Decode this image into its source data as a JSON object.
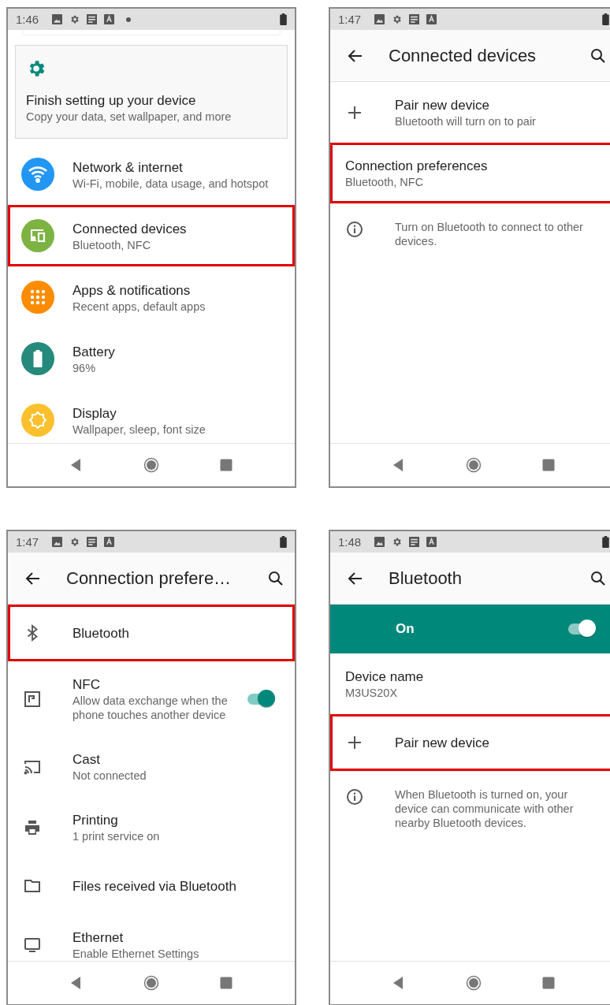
{
  "screens": [
    {
      "status": {
        "time": "1:46",
        "notification_dot": true
      },
      "items": [
        {
          "kind": "card",
          "title": "Finish setting up your device",
          "subtitle": "Copy your data, set wallpaper, and more",
          "highlighted": false
        },
        {
          "kind": "row",
          "title": "Network & internet",
          "subtitle": "Wi-Fi, mobile, data usage, and hotspot",
          "highlighted": false,
          "color": "#2196f3"
        },
        {
          "kind": "row",
          "title": "Connected devices",
          "subtitle": "Bluetooth, NFC",
          "highlighted": true,
          "color": "#7cb342"
        },
        {
          "kind": "row",
          "title": "Apps & notifications",
          "subtitle": "Recent apps, default apps",
          "highlighted": false,
          "color": "#fb8c00"
        },
        {
          "kind": "row",
          "title": "Battery",
          "subtitle": "96%",
          "highlighted": false,
          "color": "#258a7c"
        },
        {
          "kind": "row",
          "title": "Display",
          "subtitle": "Wallpaper, sleep, font size",
          "highlighted": false,
          "color": "#fbc02d"
        }
      ]
    },
    {
      "status": {
        "time": "1:47"
      },
      "header": {
        "title": "Connected devices"
      },
      "items": [
        {
          "kind": "row",
          "title": "Pair new device",
          "subtitle": "Bluetooth will turn on to pair",
          "highlighted": false
        },
        {
          "kind": "plain",
          "title": "Connection preferences",
          "subtitle": "Bluetooth, NFC",
          "highlighted": true
        },
        {
          "kind": "info",
          "title": "Turn on Bluetooth to connect to other devices.",
          "highlighted": false
        }
      ]
    },
    {
      "status": {
        "time": "1:47"
      },
      "header": {
        "title": "Connection prefere…"
      },
      "items": [
        {
          "kind": "row",
          "title": "Bluetooth",
          "highlighted": true
        },
        {
          "kind": "row",
          "title": "NFC",
          "subtitle": "Allow data exchange when the phone touches another device",
          "highlighted": false,
          "on": true
        },
        {
          "kind": "row",
          "title": "Cast",
          "subtitle": "Not connected",
          "highlighted": false
        },
        {
          "kind": "row",
          "title": "Printing",
          "subtitle": "1 print service on",
          "highlighted": false
        },
        {
          "kind": "row",
          "title": "Files received via Bluetooth",
          "highlighted": false
        },
        {
          "kind": "row",
          "title": "Ethernet",
          "subtitle": "Enable Ethernet Settings",
          "highlighted": false
        }
      ]
    },
    {
      "status": {
        "time": "1:48"
      },
      "header": {
        "title": "Bluetooth"
      },
      "items": [
        {
          "kind": "master_switch",
          "title": "On",
          "on": true,
          "highlighted": false
        },
        {
          "kind": "plain",
          "title": "Device name",
          "subtitle": "M3US20X",
          "highlighted": false
        },
        {
          "kind": "row",
          "title": "Pair new device",
          "highlighted": true
        },
        {
          "kind": "info",
          "title": "When Bluetooth is turned on, your device can communicate with other nearby Bluetooth devices.",
          "highlighted": false
        }
      ]
    }
  ]
}
